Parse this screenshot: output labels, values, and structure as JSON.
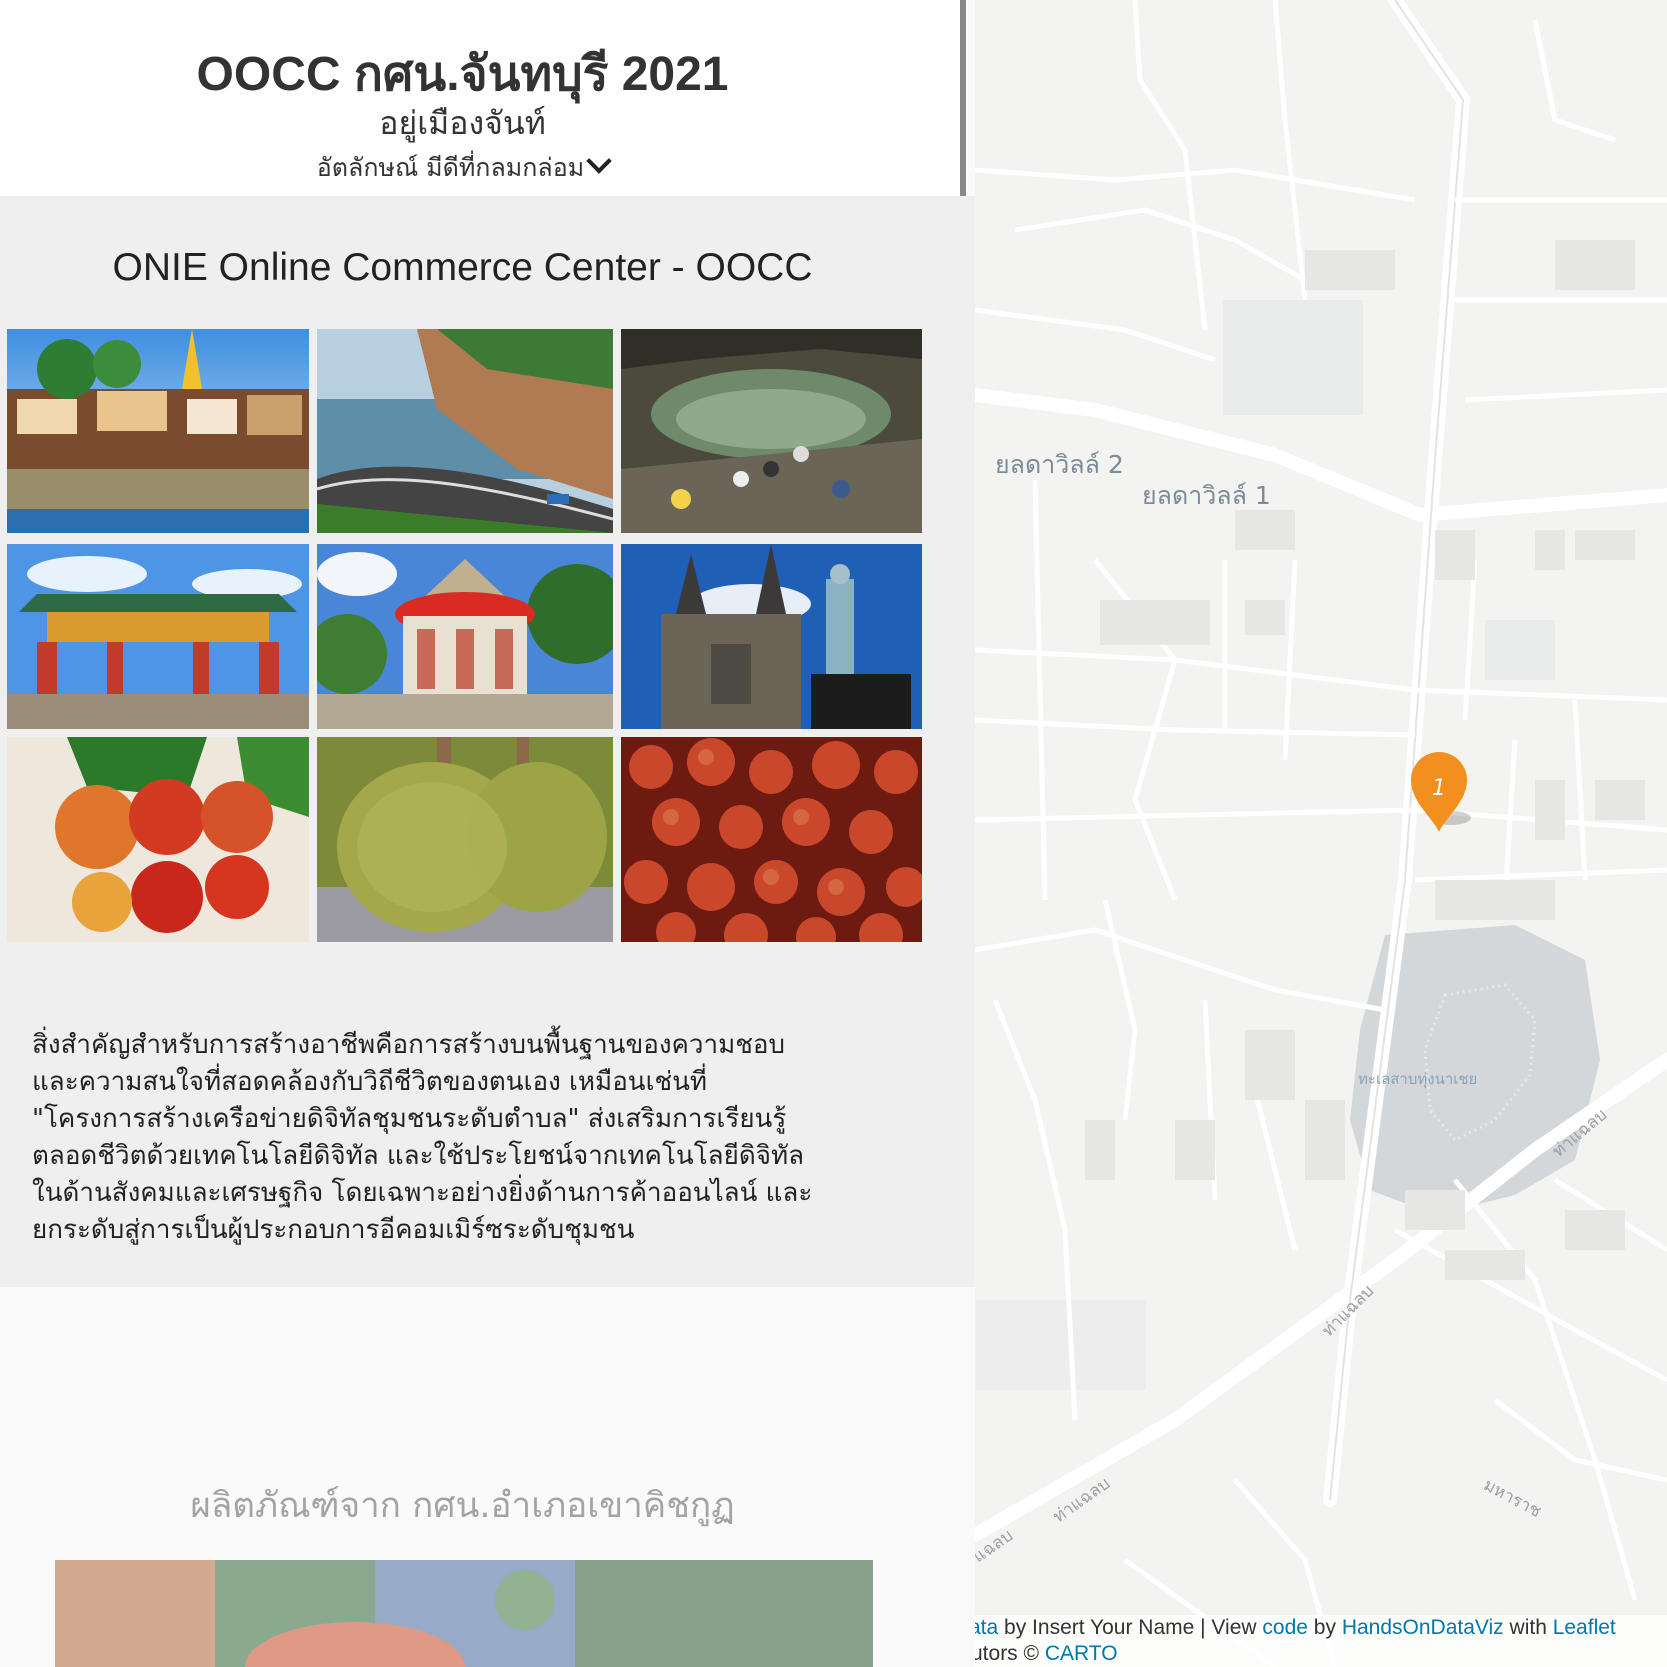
{
  "header": {
    "title": "OOCC กศน.จันทบุรี 2021",
    "subtitle": "อยู่เมืองจันท์",
    "tagline": "อัตลักษณ์ มีดีที่กลมกล่อม"
  },
  "section1": {
    "title": "ONIE Online Commerce Center - OOCC",
    "gallery": [
      {
        "name": "riverside-community-photo"
      },
      {
        "name": "coastal-road-photo"
      },
      {
        "name": "rock-pool-photo"
      },
      {
        "name": "chinese-gate-photo"
      },
      {
        "name": "pavilion-shrine-photo"
      },
      {
        "name": "cathedral-photo"
      },
      {
        "name": "rambutan-photo"
      },
      {
        "name": "durian-photo"
      },
      {
        "name": "salak-photo"
      }
    ],
    "intro_lines": [
      "สิ่งสำคัญสำหรับการสร้างอาชีพคือการสร้างบนพื้นฐานของความชอบ",
      "และความสนใจที่สอดคล้องกับวิถีชีวิตของตนเอง เหมือนเช่นที่",
      "\"โครงการสร้างเครือข่ายดิจิทัลชุมชนระดับตำบล\" ส่งเสริมการเรียนรู้",
      "ตลอดชีวิตด้วยเทคโนโลยีดิจิทัล และใช้ประโยชน์จากเทคโนโลยีดิจิทัล",
      "ในด้านสังคมและเศรษฐกิจ โดยเฉพาะอย่างยิ่งด้านการค้าออนไลน์ และ",
      "ยกระดับสู่การเป็นผู้ประกอบการอีคอมเมิร์ซระดับชุมชน"
    ]
  },
  "section2": {
    "title": "ผลิตภัณฑ์จาก กศน.อำเภอเขาคิชกูฏ"
  },
  "map": {
    "labels": {
      "village2": "ยลดาวิลล์ 2",
      "village1": "ยลดาวิลล์ 1",
      "lake": "ทะเลสาบทุ่งนาเชย",
      "road_thalaem_1": "ท่าแฉลบ",
      "road_thalaem_2": "ท่าแฉลบ",
      "road_thalaem_3": "ท่าแฉลบ",
      "road_thalaem_4": "ท่าแฉลบ",
      "road_thalaem_5": "แฉลบ",
      "road_maharat": "มหาราช"
    },
    "marker": {
      "number": "1",
      "color": "#f28f1f"
    },
    "attribution": {
      "part1": "ata",
      "text1": " by Insert Your Name | View ",
      "link2": "code",
      "text2": " by ",
      "link3": "HandsOnDataViz",
      "text3": " with ",
      "link4": "Leaflet",
      "row2_text": "utors © ",
      "row2_link": "CARTO"
    }
  }
}
